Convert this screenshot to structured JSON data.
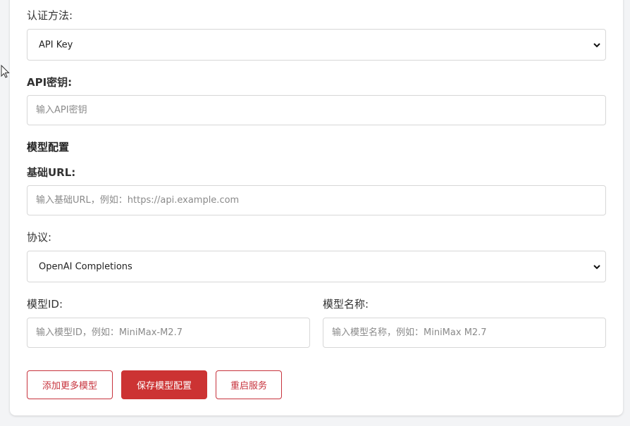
{
  "auth": {
    "method_label": "认证方法:",
    "method_value": "API Key",
    "api_key_label": "API密钥:",
    "api_key_placeholder": "输入API密钥",
    "api_key_value": ""
  },
  "model_config": {
    "section_title": "模型配置",
    "base_url_label": "基础URL:",
    "base_url_placeholder": "输入基础URL，例如：https://api.example.com",
    "base_url_value": "",
    "protocol_label": "协议:",
    "protocol_value": "OpenAI Completions",
    "model_id_label": "模型ID:",
    "model_id_placeholder": "输入模型ID，例如：MiniMax-M2.7",
    "model_id_value": "",
    "model_name_label": "模型名称:",
    "model_name_placeholder": "输入模型名称，例如：MiniMax M2.7",
    "model_name_value": ""
  },
  "actions": {
    "add_models": "添加更多模型",
    "save_config": "保存模型配置",
    "restart_service": "重启服务"
  },
  "colors": {
    "accent": "#cc3333",
    "border": "#d7d7d7",
    "placeholder": "#8a8a8a"
  }
}
